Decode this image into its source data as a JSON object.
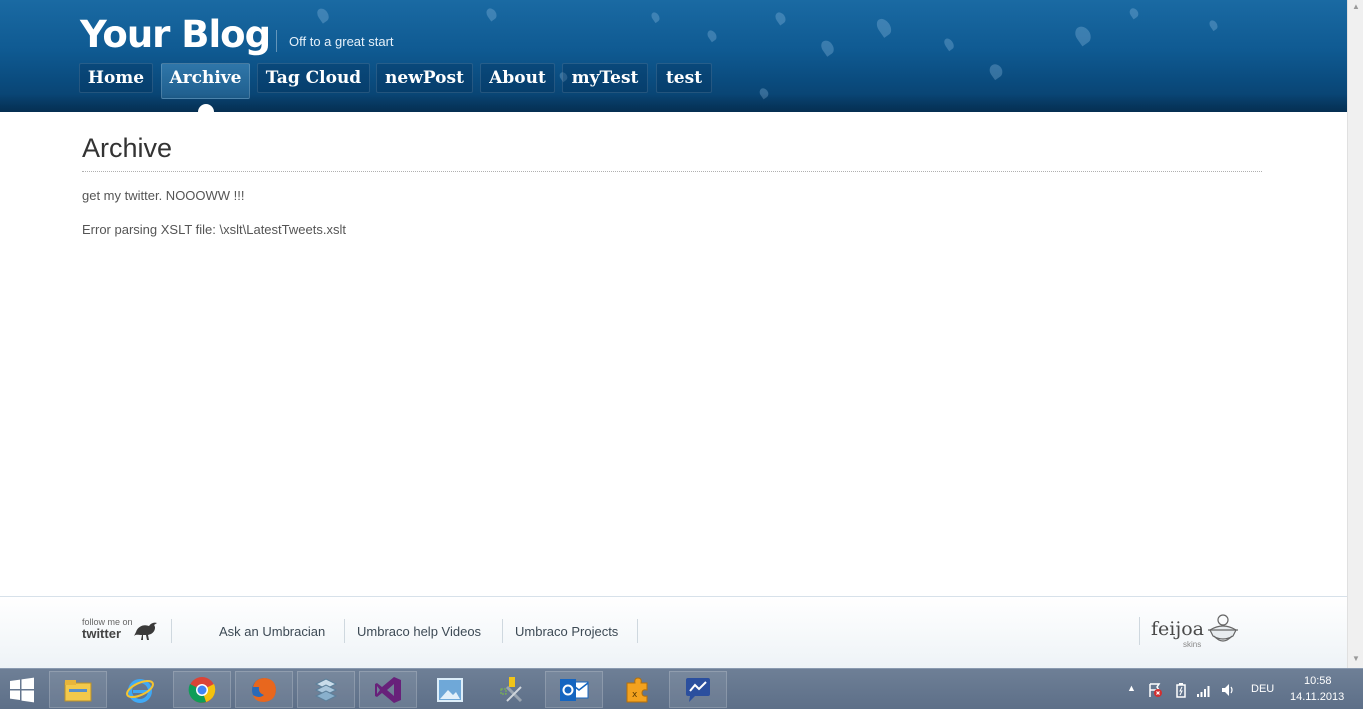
{
  "header": {
    "site_title": "Your Blog",
    "tagline": "Off to a great start",
    "nav": [
      {
        "label": "Home",
        "active": false
      },
      {
        "label": "Archive",
        "active": true
      },
      {
        "label": "Tag Cloud",
        "active": false
      },
      {
        "label": "newPost",
        "active": false
      },
      {
        "label": "About",
        "active": false
      },
      {
        "label": "myTest",
        "active": false
      },
      {
        "label": "test",
        "active": false
      }
    ]
  },
  "main": {
    "page_title": "Archive",
    "paragraphs": [
      "get my twitter. NOOOWW !!!",
      "Error parsing XSLT file: \\xslt\\LatestTweets.xslt"
    ]
  },
  "footer": {
    "twitter_small": "follow me on",
    "twitter_big": "twitter",
    "links": [
      "Ask an Umbracian",
      "Umbraco help Videos",
      "Umbraco Projects"
    ],
    "brand_name": "feijoa",
    "brand_sub": "skins"
  },
  "taskbar": {
    "apps": [
      "file-explorer-icon",
      "internet-explorer-icon",
      "chrome-icon",
      "firefox-icon",
      "stack-app-icon",
      "visual-studio-icon",
      "image-viewer-icon",
      "tools-icon",
      "outlook-icon",
      "puzzle-app-icon",
      "chart-app-icon"
    ],
    "language": "DEU",
    "time": "10:58",
    "date": "14.11.2013"
  },
  "colors": {
    "header_blue": "#0f5a92",
    "text_gray": "#555555",
    "taskbar": "#5d6f88"
  }
}
